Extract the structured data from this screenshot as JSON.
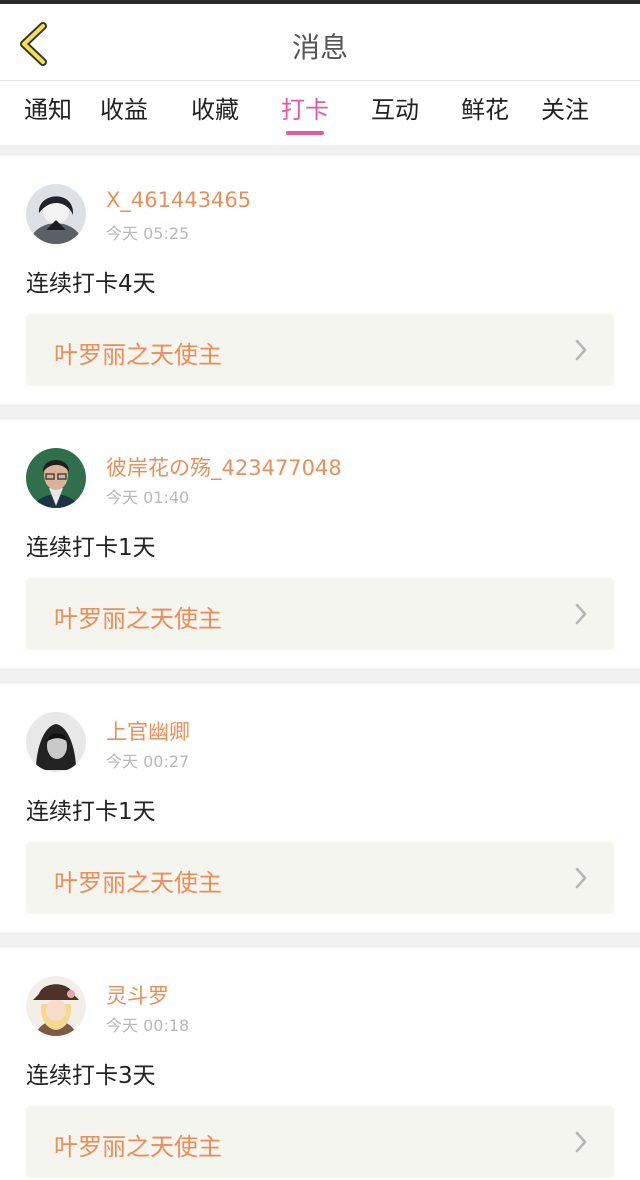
{
  "header": {
    "title": "消息",
    "back_icon": "chevron-left-icon"
  },
  "tabs": [
    {
      "label": "通知",
      "active": false
    },
    {
      "label": "收益",
      "active": false
    },
    {
      "label": "收藏",
      "active": false
    },
    {
      "label": "打卡",
      "active": true
    },
    {
      "label": "互动",
      "active": false
    },
    {
      "label": "鲜花",
      "active": false
    },
    {
      "label": "关注",
      "active": false
    }
  ],
  "colors": {
    "accent": "#e7589d",
    "username": "#ea8f5a",
    "book_title": "#ef8b55",
    "book_background": "#f4f5ee",
    "page_background": "#f1f1f1"
  },
  "messages": [
    {
      "username": "X_461443465",
      "time": "今天 05:25",
      "text": "连续打卡4天",
      "book": "叶罗丽之天使主",
      "avatar_icon": "avatar"
    },
    {
      "username": "彼岸花の殇_423477048",
      "time": "今天 01:40",
      "text": "连续打卡1天",
      "book": "叶罗丽之天使主",
      "avatar_icon": "avatar"
    },
    {
      "username": "上官幽卿",
      "time": "今天 00:27",
      "text": "连续打卡1天",
      "book": "叶罗丽之天使主",
      "avatar_icon": "avatar"
    },
    {
      "username": "灵斗罗",
      "time": "今天 00:18",
      "text": "连续打卡3天",
      "book": "叶罗丽之天使主",
      "avatar_icon": "avatar"
    }
  ]
}
